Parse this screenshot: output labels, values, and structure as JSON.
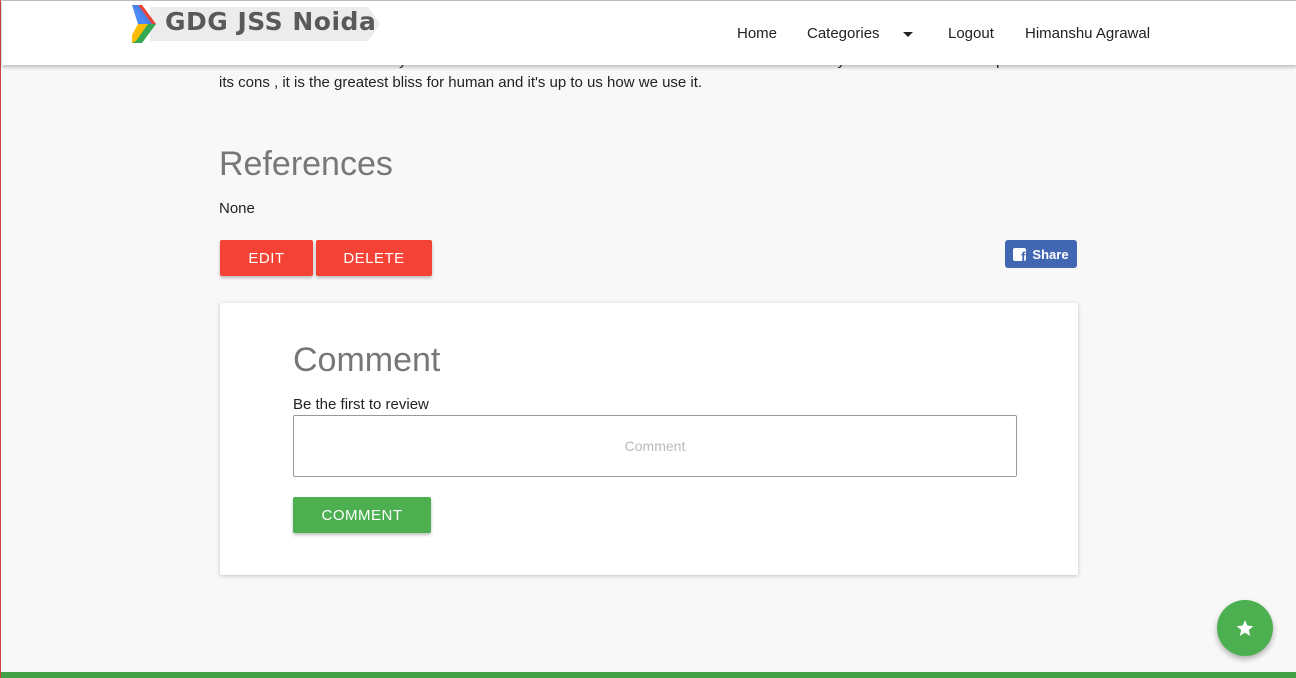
{
  "brand": {
    "logo_text": "GDG  JSS Noida",
    "colors": {
      "blue": "#4285f4",
      "red": "#ea4335",
      "yellow": "#fbbc05",
      "green": "#34a853"
    }
  },
  "nav": {
    "home": "Home",
    "categories": "Categories",
    "logout": "Logout",
    "user": "Himanshu Agrawal"
  },
  "article": {
    "lines": [
      "become common now a days but we should use it with  measures and for the sake of humanity . We cannt denied it's pros due to",
      "its cons , it is the greatest bliss for human and it's up to us how we use it."
    ]
  },
  "references": {
    "heading": "References",
    "body": "None"
  },
  "actions": {
    "edit_label": "EDIT",
    "delete_label": "DELETE",
    "share_label": "Share",
    "danger_color": "#f44336",
    "facebook_color": "#4267b2"
  },
  "comment": {
    "title": "Comment",
    "hint": "Be the first to review",
    "placeholder": "Comment",
    "value": "",
    "submit_label": "COMMENT",
    "accent_color": "#4caf50"
  },
  "fab": {
    "icon": "star-icon"
  }
}
